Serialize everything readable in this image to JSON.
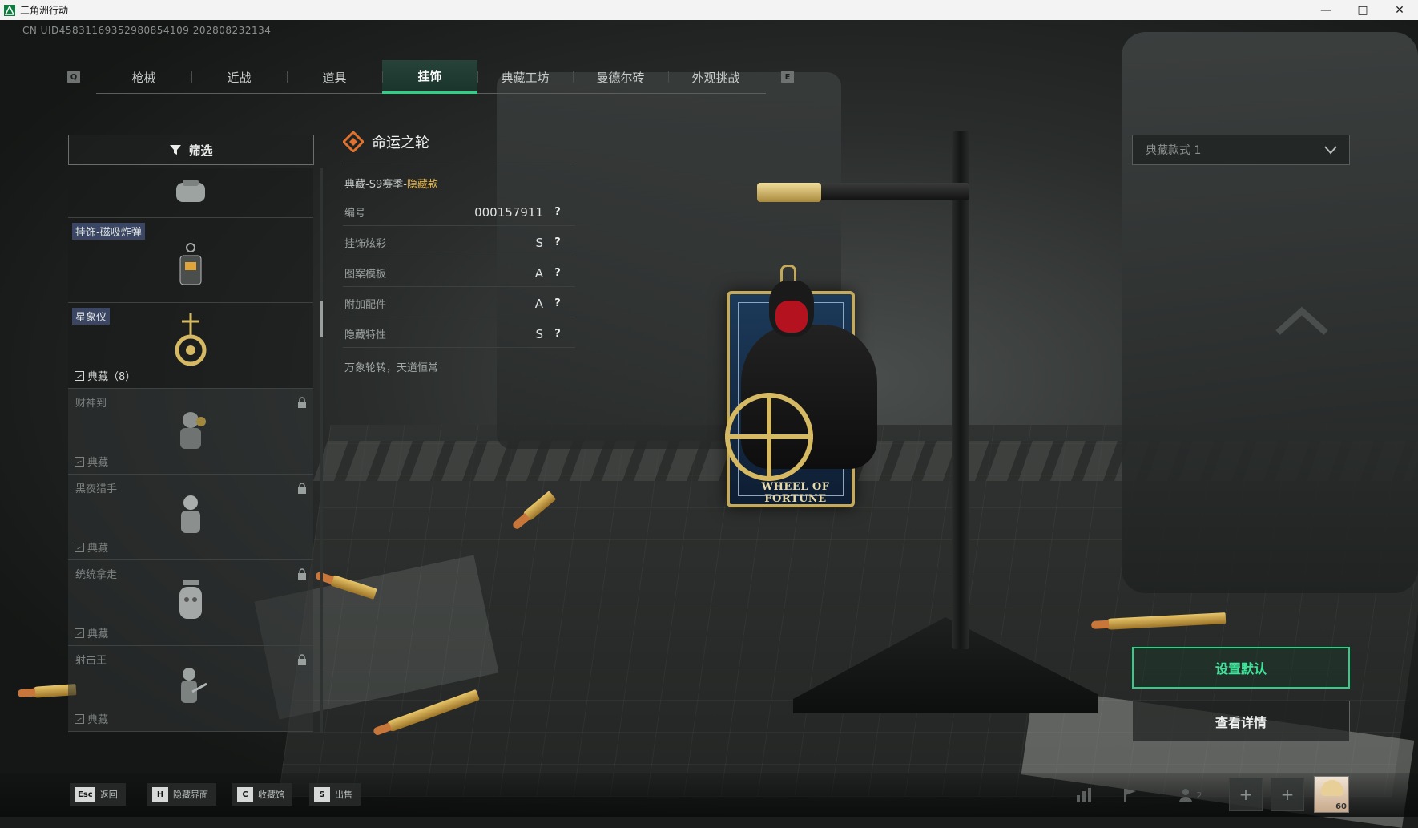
{
  "window": {
    "title": "三角洲行动",
    "minimize": "—",
    "maximize": "□",
    "close": "✕"
  },
  "uid": "CN UID4583116935298085410​9 20280823213​4",
  "tabs": {
    "left_key": "Q",
    "right_key": "E",
    "items": [
      {
        "label": "枪械",
        "active": false
      },
      {
        "label": "近战",
        "active": false
      },
      {
        "label": "道具",
        "active": false
      },
      {
        "label": "挂饰",
        "active": true
      },
      {
        "label": "典藏工坊",
        "active": false
      },
      {
        "label": "曼德尔砖",
        "active": false
      },
      {
        "label": "外观挑战",
        "active": false
      }
    ]
  },
  "filter": {
    "label": "筛选",
    "icon": "filter-icon"
  },
  "items": [
    {
      "name": "",
      "tier": "",
      "locked": false,
      "icon": "bag-charm-icon"
    },
    {
      "name": "挂饰-磁吸炸弹",
      "tier": "",
      "locked": false,
      "icon": "bomb-charm-icon",
      "highlight": true
    },
    {
      "name": "星象仪",
      "tier": "典藏（8）",
      "locked": false,
      "icon": "astrolabe-charm-icon",
      "highlight": true
    },
    {
      "name": "财神到",
      "tier": "典藏",
      "locked": true,
      "icon": "fortune-charm-icon"
    },
    {
      "name": "黑夜猎手",
      "tier": "典藏",
      "locked": true,
      "icon": "hunter-charm-icon"
    },
    {
      "name": "统统拿走",
      "tier": "典藏",
      "locked": true,
      "icon": "takeall-charm-icon"
    },
    {
      "name": "射击王",
      "tier": "典藏",
      "locked": true,
      "icon": "shooter-charm-icon"
    }
  ],
  "detail": {
    "title": "命运之轮",
    "subtitle_prefix": "典藏-S9赛季-",
    "subtitle_hidden": "隐藏款",
    "rows": [
      {
        "label": "编号",
        "value": "000157911"
      },
      {
        "label": "挂饰炫彩",
        "value": "S"
      },
      {
        "label": "图案模板",
        "value": "A"
      },
      {
        "label": "附加配件",
        "value": "A"
      },
      {
        "label": "隐藏特性",
        "value": "S"
      }
    ],
    "motto": "万象轮转，天道恒常",
    "charm_text": "WHEEL OF FORTUNE"
  },
  "style_select": {
    "value": "典藏款式 1"
  },
  "buttons": {
    "set_default": "设置默认",
    "view_details": "查看详情"
  },
  "hotkeys": [
    {
      "key": "Esc",
      "label": "返回"
    },
    {
      "key": "H",
      "label": "隐藏界面"
    },
    {
      "key": "C",
      "label": "收藏馆"
    },
    {
      "key": "S",
      "label": "出售"
    }
  ],
  "status": {
    "party_count": "2",
    "level": "60"
  },
  "colors": {
    "accent": "#2fcf86",
    "hidden_tag": "#e6b64f",
    "charm_gold": "#c5aa5c"
  }
}
